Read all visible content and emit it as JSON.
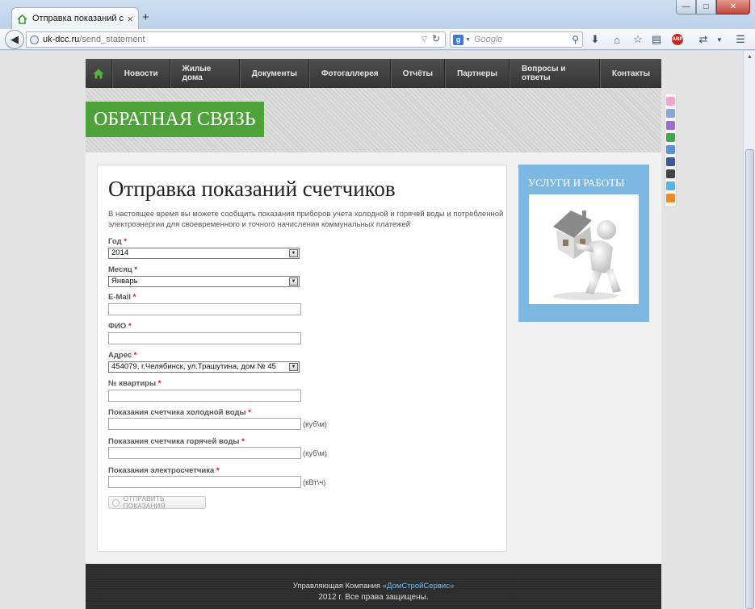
{
  "browser": {
    "tab_title": "Отправка показаний счет...",
    "tab_close": "×",
    "new_tab": "+",
    "url_host": "uk-dcc.ru",
    "url_path": "/send_statement",
    "search_placeholder": "Google",
    "search_engine_letter": "g",
    "abp_label": "ABP",
    "window_controls": {
      "minimize": "—",
      "maximize": "□",
      "close": "✕"
    }
  },
  "site": {
    "nav": {
      "items": [
        {
          "label": "Новости"
        },
        {
          "label": "Жилые дома"
        },
        {
          "label": "Документы"
        },
        {
          "label": "Фотогаллерея"
        },
        {
          "label": "Отчёты"
        },
        {
          "label": "Партнеры"
        },
        {
          "label": "Вопросы и ответы"
        },
        {
          "label": "Контакты"
        }
      ]
    },
    "banner_title": "ОБРАТНАЯ СВЯЗЬ",
    "page_heading": "Отправка показаний счетчиков",
    "intro": "В настоящее время вы можете сообщить показания приборов учета холодной и горячей воды и потребленной электроэнергии для своевременного и точного начисления коммунальных платежей",
    "form": {
      "required_mark": "*",
      "year": {
        "label": "Год",
        "value": "2014"
      },
      "month": {
        "label": "Месяц",
        "value": "Январь"
      },
      "email": {
        "label": "E-Mail",
        "value": ""
      },
      "fio": {
        "label": "ФИО",
        "value": ""
      },
      "address": {
        "label": "Адрес",
        "value": "454079, г.Челябинск, ул.Трашутина, дом № 45"
      },
      "apartment": {
        "label": "№ квартиры",
        "value": ""
      },
      "cold_water": {
        "label": "Показания счетчика холодной воды",
        "unit": "(куб\\м)",
        "value": ""
      },
      "hot_water": {
        "label": "Показания счетчика горячей воды",
        "unit": "(куб\\м)",
        "value": ""
      },
      "electricity": {
        "label": "Показания электросчетчика",
        "unit": "(кВт\\ч)",
        "value": ""
      },
      "submit_label": "ОТПРАВИТЬ ПОКАЗАНИЯ"
    },
    "sidebar": {
      "title": "УСЛУГИ И РАБОТЫ"
    },
    "footer": {
      "line1_prefix": "Управляющая Компания ",
      "line1_link": "«ДомСтройСервис»",
      "line2": "2012 г. Все права защищены."
    },
    "colors": {
      "nav_bg": "#3f3f3f",
      "banner_green": "#4ea23a",
      "sidebar_blue": "#7db8e3",
      "required_red": "#dd1111",
      "footer_link": "#79b9ea"
    }
  }
}
